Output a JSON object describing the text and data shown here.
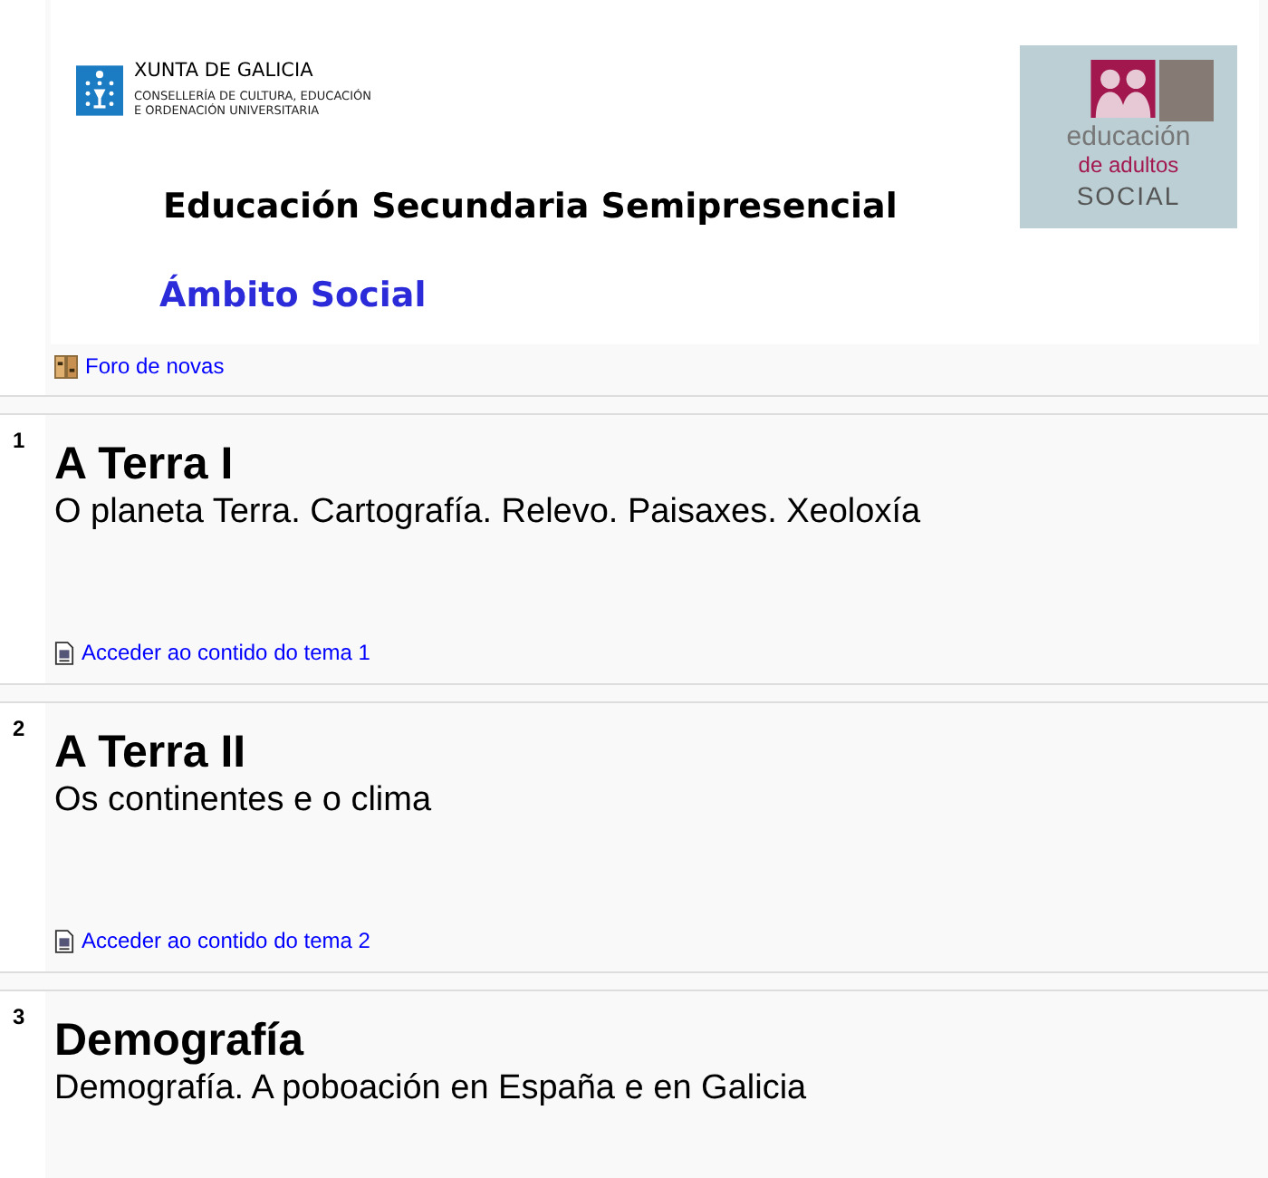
{
  "header": {
    "organization": "XUNTA DE GALICIA",
    "department_lines": [
      "CONSELLERÍA DE CULTURA, EDUCACIÓN",
      "E ORDENACIÓN UNIVERSITARIA"
    ],
    "title": "Educación Secundaria Semipresencial",
    "subtitle": "Ámbito Social",
    "badge": {
      "top": "educación",
      "middle": "de adultos",
      "bottom": "SOCIAL"
    }
  },
  "forum_link": "Foro de novas",
  "sections": [
    {
      "number": "1",
      "title": "A Terra I",
      "summary": "O planeta Terra. Cartografía. Relevo. Paisaxes. Xeoloxía",
      "link": "Acceder ao contido do tema 1"
    },
    {
      "number": "2",
      "title": "A Terra II",
      "summary": "Os continentes e o clima",
      "link": "Acceder ao contido do tema 2"
    },
    {
      "number": "3",
      "title": "Demografía",
      "summary": "Demografía. A poboación en España e en Galicia"
    }
  ]
}
